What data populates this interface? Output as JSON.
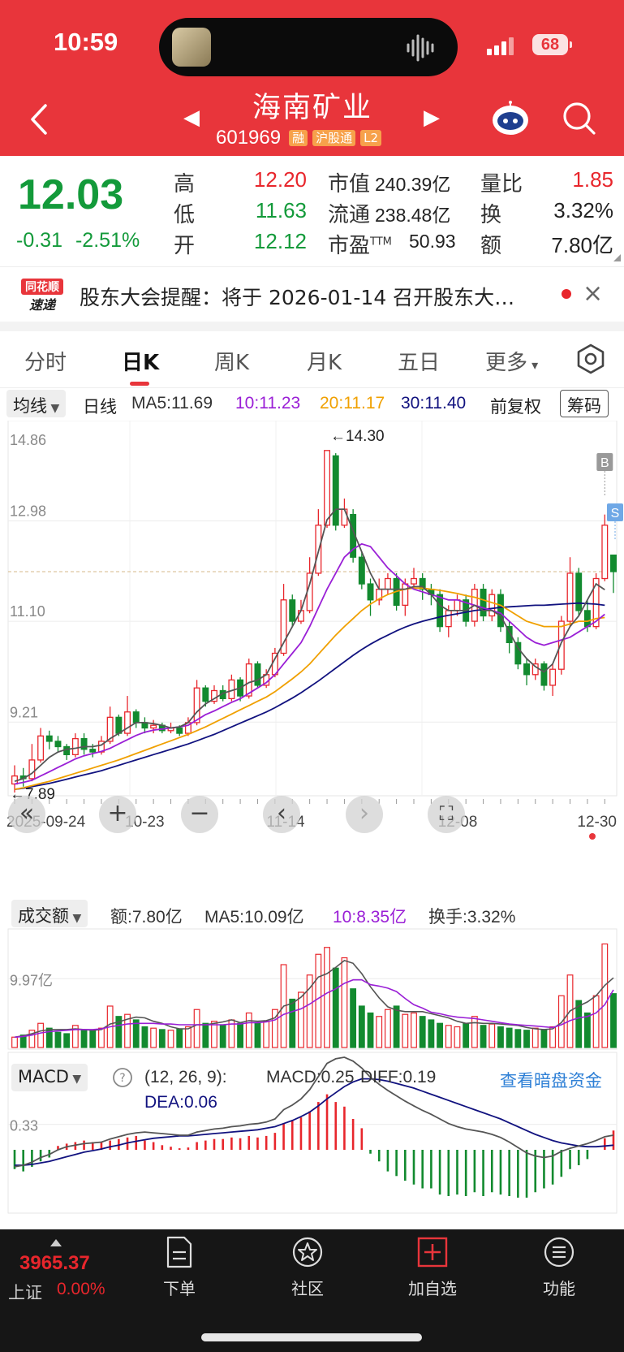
{
  "status": {
    "time": "10:59",
    "battery": "68"
  },
  "header": {
    "name": "海南矿业",
    "code": "601969",
    "tags": [
      "融",
      "沪股通",
      "L2"
    ]
  },
  "quote": {
    "price": "12.03",
    "change": "-0.31",
    "change_pct": "-2.51%",
    "high_label": "高",
    "high": "12.20",
    "low_label": "低",
    "low": "11.63",
    "open_label": "开",
    "open": "12.12",
    "mcap_label": "市值",
    "mcap": "240.39亿",
    "float_label": "流通",
    "float": "238.48亿",
    "pe_label": "市盈",
    "pe_sup": "TTM",
    "pe": "50.93",
    "vr_label": "量比",
    "vr": "1.85",
    "turn_label": "换",
    "turn": "3.32%",
    "amt_label": "额",
    "amt": "7.80亿"
  },
  "news": {
    "logo_top": "同花顺",
    "logo_bottom": "速递",
    "text": "股东大会提醒：将于 2026-01-14 召开股东大…"
  },
  "tabs": [
    "分时",
    "日K",
    "周K",
    "月K",
    "五日",
    "更多"
  ],
  "indicators": {
    "dropdown": "均线",
    "period": "日线",
    "ma5": "MA5:11.69",
    "ma10": "10:11.23",
    "ma20": "20:11.17",
    "ma30": "30:11.40",
    "adjust": "前复权",
    "chip": "筹码"
  },
  "chart": {
    "y_labels": [
      "14.86",
      "12.98",
      "11.10",
      "9.21"
    ],
    "x_labels": [
      "2025-09-24",
      "10-23",
      "11-14",
      "12-08",
      "12-30"
    ],
    "max_label": "←14.30",
    "min_label": "←7.89",
    "marker_b": "B",
    "marker_s": "S"
  },
  "volume": {
    "dropdown": "成交额",
    "amt": "额:7.80亿",
    "ma5": "MA5:10.09亿",
    "ma10": "10:8.35亿",
    "turn": "换手:3.32%",
    "y_label": "9.97亿"
  },
  "macd": {
    "dropdown": "MACD",
    "params": "(12, 26, 9):",
    "macd": "MACD:0.25",
    "diff": "DIFF:0.19",
    "dea": "DEA:0.06",
    "link": "查看暗盘资金",
    "y_label": "0.33"
  },
  "bottom": {
    "index_value": "3965.37",
    "index_name": "上证",
    "index_change": "0.00%",
    "items": [
      "下单",
      "社区",
      "加自选",
      "功能"
    ]
  },
  "chart_data": {
    "type": "candlestick",
    "ylim": [
      7.89,
      14.86
    ],
    "candles": [
      {
        "o": 8.05,
        "c": 8.2,
        "h": 8.4,
        "l": 7.89
      },
      {
        "o": 8.2,
        "c": 8.15,
        "h": 8.35,
        "l": 8.0
      },
      {
        "o": 8.15,
        "c": 8.5,
        "h": 8.8,
        "l": 8.1
      },
      {
        "o": 8.5,
        "c": 8.95,
        "h": 9.1,
        "l": 8.45
      },
      {
        "o": 8.95,
        "c": 8.85,
        "h": 9.05,
        "l": 8.7
      },
      {
        "o": 8.85,
        "c": 8.75,
        "h": 8.95,
        "l": 8.65
      },
      {
        "o": 8.75,
        "c": 8.6,
        "h": 8.8,
        "l": 8.5
      },
      {
        "o": 8.6,
        "c": 8.9,
        "h": 9.0,
        "l": 8.55
      },
      {
        "o": 8.9,
        "c": 8.7,
        "h": 9.0,
        "l": 8.6
      },
      {
        "o": 8.7,
        "c": 8.65,
        "h": 8.8,
        "l": 8.55
      },
      {
        "o": 8.65,
        "c": 8.85,
        "h": 8.95,
        "l": 8.6
      },
      {
        "o": 8.85,
        "c": 9.3,
        "h": 9.5,
        "l": 8.8
      },
      {
        "o": 9.3,
        "c": 9.0,
        "h": 9.35,
        "l": 8.95
      },
      {
        "o": 9.0,
        "c": 9.4,
        "h": 9.7,
        "l": 8.95
      },
      {
        "o": 9.4,
        "c": 9.2,
        "h": 9.45,
        "l": 9.1
      },
      {
        "o": 9.2,
        "c": 9.1,
        "h": 9.3,
        "l": 9.0
      },
      {
        "o": 9.1,
        "c": 9.15,
        "h": 9.25,
        "l": 9.0
      },
      {
        "o": 9.15,
        "c": 9.05,
        "h": 9.2,
        "l": 9.0
      },
      {
        "o": 9.05,
        "c": 9.1,
        "h": 9.2,
        "l": 9.0
      },
      {
        "o": 9.1,
        "c": 9.0,
        "h": 9.15,
        "l": 8.95
      },
      {
        "o": 9.0,
        "c": 9.2,
        "h": 9.3,
        "l": 8.95
      },
      {
        "o": 9.2,
        "c": 9.85,
        "h": 10.0,
        "l": 9.15
      },
      {
        "o": 9.85,
        "c": 9.6,
        "h": 9.9,
        "l": 9.5
      },
      {
        "o": 9.6,
        "c": 9.8,
        "h": 9.9,
        "l": 9.55
      },
      {
        "o": 9.8,
        "c": 9.65,
        "h": 9.9,
        "l": 9.6
      },
      {
        "o": 9.65,
        "c": 10.0,
        "h": 10.1,
        "l": 9.6
      },
      {
        "o": 10.0,
        "c": 9.7,
        "h": 10.05,
        "l": 9.6
      },
      {
        "o": 9.7,
        "c": 10.3,
        "h": 10.4,
        "l": 9.65
      },
      {
        "o": 10.3,
        "c": 9.9,
        "h": 10.35,
        "l": 9.85
      },
      {
        "o": 9.9,
        "c": 10.1,
        "h": 10.2,
        "l": 9.85
      },
      {
        "o": 10.1,
        "c": 10.5,
        "h": 10.6,
        "l": 10.05
      },
      {
        "o": 10.5,
        "c": 11.5,
        "h": 11.8,
        "l": 10.45
      },
      {
        "o": 11.5,
        "c": 11.1,
        "h": 11.6,
        "l": 11.0
      },
      {
        "o": 11.1,
        "c": 11.3,
        "h": 11.5,
        "l": 11.05
      },
      {
        "o": 11.3,
        "c": 12.0,
        "h": 12.3,
        "l": 11.25
      },
      {
        "o": 12.0,
        "c": 12.9,
        "h": 13.2,
        "l": 11.95
      },
      {
        "o": 12.9,
        "c": 14.3,
        "h": 14.3,
        "l": 12.85
      },
      {
        "o": 14.2,
        "c": 12.9,
        "h": 14.25,
        "l": 12.8
      },
      {
        "o": 12.9,
        "c": 13.2,
        "h": 13.4,
        "l": 12.85
      },
      {
        "o": 13.1,
        "c": 12.3,
        "h": 13.2,
        "l": 12.2
      },
      {
        "o": 12.3,
        "c": 11.8,
        "h": 12.4,
        "l": 11.7
      },
      {
        "o": 11.8,
        "c": 11.5,
        "h": 11.9,
        "l": 11.2
      },
      {
        "o": 11.5,
        "c": 11.7,
        "h": 11.9,
        "l": 11.4
      },
      {
        "o": 11.7,
        "c": 11.9,
        "h": 12.0,
        "l": 11.6
      },
      {
        "o": 11.9,
        "c": 11.4,
        "h": 12.0,
        "l": 11.3
      },
      {
        "o": 11.4,
        "c": 11.8,
        "h": 11.9,
        "l": 11.2
      },
      {
        "o": 11.8,
        "c": 11.9,
        "h": 12.1,
        "l": 11.7
      },
      {
        "o": 11.9,
        "c": 11.7,
        "h": 12.0,
        "l": 11.5
      },
      {
        "o": 11.7,
        "c": 11.6,
        "h": 11.8,
        "l": 11.4
      },
      {
        "o": 11.6,
        "c": 11.0,
        "h": 11.7,
        "l": 10.9
      },
      {
        "o": 11.0,
        "c": 11.3,
        "h": 11.4,
        "l": 10.8
      },
      {
        "o": 11.3,
        "c": 11.5,
        "h": 11.6,
        "l": 11.2
      },
      {
        "o": 11.5,
        "c": 11.1,
        "h": 11.6,
        "l": 11.0
      },
      {
        "o": 11.1,
        "c": 11.7,
        "h": 11.8,
        "l": 11.0
      },
      {
        "o": 11.7,
        "c": 11.2,
        "h": 11.8,
        "l": 11.1
      },
      {
        "o": 11.2,
        "c": 11.6,
        "h": 11.7,
        "l": 11.1
      },
      {
        "o": 11.6,
        "c": 11.0,
        "h": 11.7,
        "l": 10.9
      },
      {
        "o": 11.0,
        "c": 10.7,
        "h": 11.1,
        "l": 10.5
      },
      {
        "o": 10.7,
        "c": 10.3,
        "h": 10.8,
        "l": 10.2
      },
      {
        "o": 10.3,
        "c": 10.1,
        "h": 10.4,
        "l": 9.9
      },
      {
        "o": 10.1,
        "c": 10.3,
        "h": 10.4,
        "l": 10.0
      },
      {
        "o": 10.3,
        "c": 9.9,
        "h": 10.35,
        "l": 9.8
      },
      {
        "o": 9.9,
        "c": 10.2,
        "h": 10.3,
        "l": 9.7
      },
      {
        "o": 10.2,
        "c": 11.1,
        "h": 11.2,
        "l": 10.1
      },
      {
        "o": 11.1,
        "c": 12.0,
        "h": 12.3,
        "l": 11.0
      },
      {
        "o": 12.0,
        "c": 11.3,
        "h": 12.1,
        "l": 11.2
      },
      {
        "o": 11.3,
        "c": 11.0,
        "h": 11.5,
        "l": 10.9
      },
      {
        "o": 11.0,
        "c": 11.9,
        "h": 12.0,
        "l": 10.95
      },
      {
        "o": 11.9,
        "c": 12.9,
        "h": 13.1,
        "l": 11.85
      },
      {
        "o": 12.34,
        "c": 12.03,
        "h": 12.2,
        "l": 11.63
      }
    ],
    "ma5": [
      8.1,
      8.15,
      8.25,
      8.4,
      8.55,
      8.65,
      8.7,
      8.72,
      8.75,
      8.75,
      8.78,
      8.9,
      9.0,
      9.1,
      9.2,
      9.2,
      9.18,
      9.15,
      9.1,
      9.12,
      9.2,
      9.4,
      9.55,
      9.65,
      9.75,
      9.8,
      9.85,
      9.95,
      10.0,
      10.1,
      10.4,
      10.7,
      11.0,
      11.3,
      11.8,
      12.4,
      13.0,
      13.2,
      13.2,
      12.8,
      12.4,
      12.0,
      11.7,
      11.7,
      11.7,
      11.7,
      11.75,
      11.75,
      11.6,
      11.4,
      11.3,
      11.3,
      11.3,
      11.4,
      11.3,
      11.3,
      11.2,
      10.9,
      10.6,
      10.4,
      10.25,
      10.15,
      10.3,
      10.7,
      11.0,
      11.2,
      11.5,
      11.8,
      11.69
    ],
    "ma10": [
      8.05,
      8.08,
      8.12,
      8.2,
      8.28,
      8.36,
      8.44,
      8.52,
      8.58,
      8.62,
      8.66,
      8.72,
      8.8,
      8.88,
      8.96,
      9.02,
      9.06,
      9.08,
      9.1,
      9.12,
      9.15,
      9.25,
      9.35,
      9.42,
      9.5,
      9.58,
      9.65,
      9.75,
      9.85,
      9.95,
      10.1,
      10.3,
      10.5,
      10.7,
      11.0,
      11.35,
      11.7,
      12.0,
      12.3,
      12.45,
      12.55,
      12.5,
      12.3,
      12.1,
      11.95,
      11.8,
      11.7,
      11.65,
      11.6,
      11.55,
      11.5,
      11.5,
      11.45,
      11.4,
      11.35,
      11.3,
      11.25,
      11.1,
      10.95,
      10.8,
      10.7,
      10.65,
      10.7,
      10.75,
      10.8,
      10.9,
      11.0,
      11.1,
      11.23
    ],
    "ma20": [
      7.95,
      7.98,
      8.02,
      8.06,
      8.1,
      8.15,
      8.2,
      8.25,
      8.3,
      8.35,
      8.4,
      8.45,
      8.5,
      8.56,
      8.62,
      8.68,
      8.74,
      8.8,
      8.86,
      8.92,
      8.98,
      9.05,
      9.12,
      9.2,
      9.28,
      9.36,
      9.44,
      9.52,
      9.6,
      9.68,
      9.78,
      9.9,
      10.02,
      10.15,
      10.3,
      10.48,
      10.66,
      10.84,
      11.0,
      11.15,
      11.3,
      11.42,
      11.52,
      11.6,
      11.66,
      11.7,
      11.72,
      11.72,
      11.7,
      11.68,
      11.65,
      11.62,
      11.58,
      11.55,
      11.5,
      11.45,
      11.4,
      11.3,
      11.2,
      11.1,
      11.05,
      11.0,
      11.0,
      11.0,
      11.05,
      11.1,
      11.1,
      11.15,
      11.17
    ],
    "ma30": [
      7.95,
      7.97,
      8.0,
      8.03,
      8.06,
      8.1,
      8.14,
      8.18,
      8.22,
      8.26,
      8.3,
      8.35,
      8.4,
      8.45,
      8.5,
      8.55,
      8.6,
      8.65,
      8.7,
      8.75,
      8.8,
      8.86,
      8.92,
      8.98,
      9.05,
      9.12,
      9.19,
      9.26,
      9.33,
      9.4,
      9.48,
      9.57,
      9.66,
      9.76,
      9.87,
      9.98,
      10.1,
      10.22,
      10.34,
      10.46,
      10.57,
      10.67,
      10.76,
      10.84,
      10.92,
      10.99,
      11.05,
      11.1,
      11.14,
      11.18,
      11.21,
      11.24,
      11.27,
      11.3,
      11.32,
      11.34,
      11.36,
      11.37,
      11.38,
      11.39,
      11.4,
      11.4,
      11.41,
      11.42,
      11.43,
      11.44,
      11.43,
      11.42,
      11.4
    ],
    "amount": [
      1.5,
      1.8,
      2.5,
      3.5,
      2.8,
      2.2,
      2.0,
      3.2,
      2.6,
      2.4,
      2.8,
      6.0,
      4.5,
      4.8,
      4.0,
      3.0,
      2.8,
      2.6,
      2.5,
      2.7,
      3.0,
      5.5,
      3.5,
      3.8,
      3.2,
      4.0,
      3.5,
      5.0,
      3.6,
      3.8,
      5.5,
      12.0,
      7.0,
      8.0,
      10.5,
      13.5,
      14.5,
      11.5,
      13.0,
      8.5,
      6.0,
      5.0,
      4.5,
      5.5,
      6.0,
      4.8,
      5.0,
      4.5,
      4.0,
      3.5,
      3.2,
      3.0,
      3.5,
      4.5,
      3.2,
      3.4,
      3.0,
      2.8,
      2.6,
      2.5,
      2.8,
      2.6,
      3.0,
      7.5,
      10.5,
      6.8,
      5.0,
      7.5,
      15.0,
      7.8
    ],
    "amount_ma5": [
      1.5,
      1.7,
      2.0,
      2.4,
      2.6,
      2.6,
      2.6,
      2.7,
      2.6,
      2.5,
      2.6,
      3.4,
      3.7,
      4.1,
      4.4,
      4.3,
      3.8,
      3.5,
      3.0,
      2.7,
      2.7,
      3.3,
      3.3,
      3.5,
      3.7,
      4.0,
      3.6,
      3.9,
      3.8,
      3.9,
      4.3,
      6.0,
      6.4,
      7.3,
      8.6,
      10.2,
      10.7,
      11.6,
      12.6,
      12.2,
      10.7,
      8.8,
      7.2,
      5.9,
      5.4,
      5.2,
      5.2,
      5.2,
      4.9,
      4.6,
      4.3,
      3.8,
      3.5,
      3.6,
      3.5,
      3.5,
      3.4,
      3.3,
      3.2,
      2.9,
      2.7,
      2.6,
      2.7,
      3.6,
      5.3,
      6.0,
      6.6,
      7.5,
      9.0,
      10.09
    ],
    "amount_ma10": [
      1.5,
      1.6,
      1.8,
      2.1,
      2.3,
      2.4,
      2.5,
      2.6,
      2.6,
      2.6,
      2.7,
      3.0,
      3.2,
      3.4,
      3.5,
      3.5,
      3.5,
      3.4,
      3.4,
      3.3,
      3.3,
      3.3,
      3.3,
      3.3,
      3.3,
      3.4,
      3.4,
      3.6,
      3.6,
      3.7,
      4.0,
      4.8,
      5.2,
      5.6,
      6.3,
      7.1,
      7.9,
      8.5,
      9.3,
      9.8,
      9.8,
      9.1,
      8.9,
      8.6,
      8.1,
      7.1,
      6.2,
      5.7,
      5.1,
      4.9,
      4.6,
      4.4,
      4.3,
      4.2,
      4.0,
      3.8,
      3.6,
      3.4,
      3.3,
      3.2,
      3.1,
      3.0,
      2.9,
      3.3,
      3.9,
      4.3,
      4.5,
      5.0,
      6.2,
      8.35
    ],
    "macd_hist": [
      -0.25,
      -0.28,
      -0.22,
      -0.15,
      -0.1,
      0.05,
      0.08,
      0.1,
      0.12,
      0.1,
      0.1,
      0.12,
      0.14,
      0.16,
      0.18,
      0.12,
      0.1,
      0.06,
      0.04,
      0.02,
      0.03,
      0.1,
      0.12,
      0.14,
      0.14,
      0.16,
      0.15,
      0.18,
      0.16,
      0.18,
      0.22,
      0.34,
      0.38,
      0.42,
      0.5,
      0.62,
      0.72,
      0.62,
      0.56,
      0.4,
      0.28,
      -0.05,
      -0.15,
      -0.28,
      -0.34,
      -0.4,
      -0.45,
      -0.5,
      -0.5,
      -0.58,
      -0.6,
      -0.58,
      -0.6,
      -0.55,
      -0.6,
      -0.55,
      -0.58,
      -0.6,
      -0.62,
      -0.62,
      -0.55,
      -0.5,
      -0.45,
      -0.35,
      -0.25,
      -0.2,
      -0.12,
      0.0,
      0.15,
      0.25
    ],
    "macd_diff": [
      -0.22,
      -0.2,
      -0.16,
      -0.1,
      -0.06,
      0.0,
      0.04,
      0.06,
      0.08,
      0.09,
      0.1,
      0.14,
      0.17,
      0.2,
      0.22,
      0.23,
      0.22,
      0.21,
      0.2,
      0.19,
      0.19,
      0.23,
      0.25,
      0.27,
      0.28,
      0.3,
      0.31,
      0.33,
      0.34,
      0.36,
      0.4,
      0.52,
      0.58,
      0.66,
      0.78,
      0.95,
      1.12,
      1.18,
      1.2,
      1.15,
      1.06,
      0.94,
      0.85,
      0.77,
      0.7,
      0.63,
      0.57,
      0.51,
      0.46,
      0.4,
      0.34,
      0.3,
      0.27,
      0.25,
      0.23,
      0.2,
      0.16,
      0.1,
      0.03,
      -0.04,
      -0.08,
      -0.1,
      -0.08,
      -0.02,
      0.02,
      0.05,
      0.08,
      0.12,
      0.17,
      0.19
    ],
    "macd_dea": [
      -0.2,
      -0.2,
      -0.19,
      -0.17,
      -0.15,
      -0.12,
      -0.09,
      -0.06,
      -0.03,
      -0.01,
      0.01,
      0.04,
      0.06,
      0.09,
      0.11,
      0.13,
      0.15,
      0.16,
      0.17,
      0.18,
      0.18,
      0.19,
      0.2,
      0.21,
      0.22,
      0.23,
      0.24,
      0.25,
      0.26,
      0.28,
      0.3,
      0.34,
      0.38,
      0.43,
      0.49,
      0.57,
      0.66,
      0.74,
      0.82,
      0.88,
      0.92,
      0.92,
      0.91,
      0.89,
      0.86,
      0.83,
      0.8,
      0.76,
      0.72,
      0.68,
      0.64,
      0.6,
      0.56,
      0.52,
      0.48,
      0.44,
      0.4,
      0.35,
      0.3,
      0.25,
      0.2,
      0.16,
      0.12,
      0.09,
      0.07,
      0.05,
      0.04,
      0.04,
      0.05,
      0.06
    ]
  }
}
